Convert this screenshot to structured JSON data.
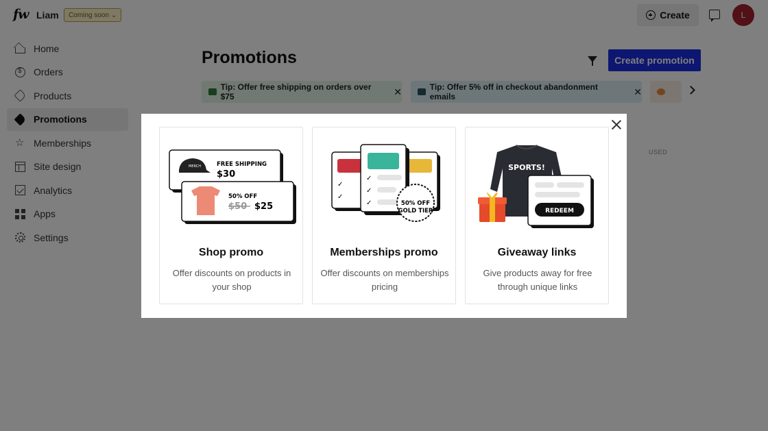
{
  "topbar": {
    "logo": "fw",
    "username": "Liam",
    "badge": "Coming soon",
    "create_label": "Create",
    "avatar_initial": "L"
  },
  "sidebar": {
    "items": [
      {
        "label": "Home",
        "icon": "home-icon"
      },
      {
        "label": "Orders",
        "icon": "dollar-circle-icon"
      },
      {
        "label": "Products",
        "icon": "tag-icon"
      },
      {
        "label": "Promotions",
        "icon": "tag-solid-icon",
        "active": true
      },
      {
        "label": "Memberships",
        "icon": "star-icon"
      },
      {
        "label": "Site design",
        "icon": "layout-icon"
      },
      {
        "label": "Analytics",
        "icon": "chart-icon"
      },
      {
        "label": "Apps",
        "icon": "apps-icon"
      },
      {
        "label": "Settings",
        "icon": "gear-icon"
      }
    ]
  },
  "main": {
    "title": "Promotions",
    "create_promotion_label": "Create promotion",
    "tips": [
      {
        "text": "Tip: Offer free shipping on orders over $75"
      },
      {
        "text": "Tip: Offer 5% off in checkout abandonment emails"
      }
    ],
    "table_header_used": "USED"
  },
  "modal": {
    "cards": [
      {
        "title": "Shop promo",
        "description": "Offer discounts on products in your shop",
        "illustration": {
          "line1": "FREE SHIPPING",
          "price1": "$30",
          "line2": "50% OFF",
          "old_price": "$50",
          "new_price": "$25"
        }
      },
      {
        "title": "Memberships promo",
        "description": "Offer discounts on memberships pricing",
        "illustration": {
          "badge_line1": "50% OFF",
          "badge_line2": "GOLD TIER"
        }
      },
      {
        "title": "Giveaway links",
        "description": "Give products away for free through unique links",
        "illustration": {
          "shirt_text": "SPORTS!",
          "button": "REDEEM"
        }
      }
    ]
  },
  "colors": {
    "primary": "#1a2de0",
    "avatar": "#a3232f",
    "overlay": "rgba(0,0,0,0.5)"
  }
}
